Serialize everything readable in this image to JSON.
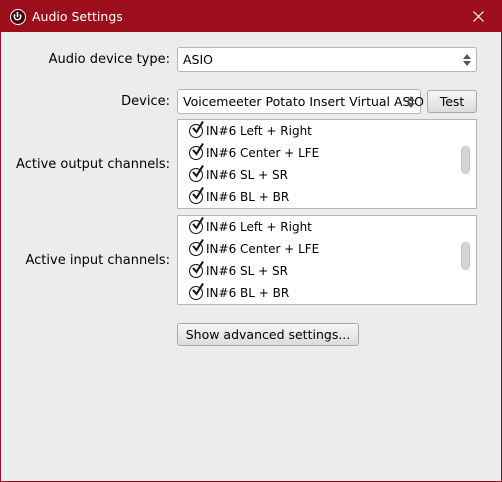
{
  "window": {
    "title": "Audio Settings"
  },
  "device_type": {
    "label": "Audio device type:",
    "value": "ASIO"
  },
  "device": {
    "label": "Device:",
    "value": "Voicemeeter Potato Insert Virtual ASIO",
    "test_label": "Test"
  },
  "output_channels": {
    "label": "Active output channels:",
    "items": [
      {
        "label": "IN#6 Left + Right",
        "checked": true
      },
      {
        "label": "IN#6 Center + LFE",
        "checked": true
      },
      {
        "label": "IN#6 SL + SR",
        "checked": true
      },
      {
        "label": "IN#6 BL + BR",
        "checked": true
      }
    ]
  },
  "input_channels": {
    "label": "Active input channels:",
    "items": [
      {
        "label": "IN#6 Left + Right",
        "checked": true
      },
      {
        "label": "IN#6 Center + LFE",
        "checked": true
      },
      {
        "label": "IN#6 SL + SR",
        "checked": true
      },
      {
        "label": "IN#6 BL + BR",
        "checked": true
      }
    ]
  },
  "advanced": {
    "label": "Show advanced settings..."
  },
  "colors": {
    "titlebar": "#9c0e1c",
    "panel": "#ececec"
  }
}
